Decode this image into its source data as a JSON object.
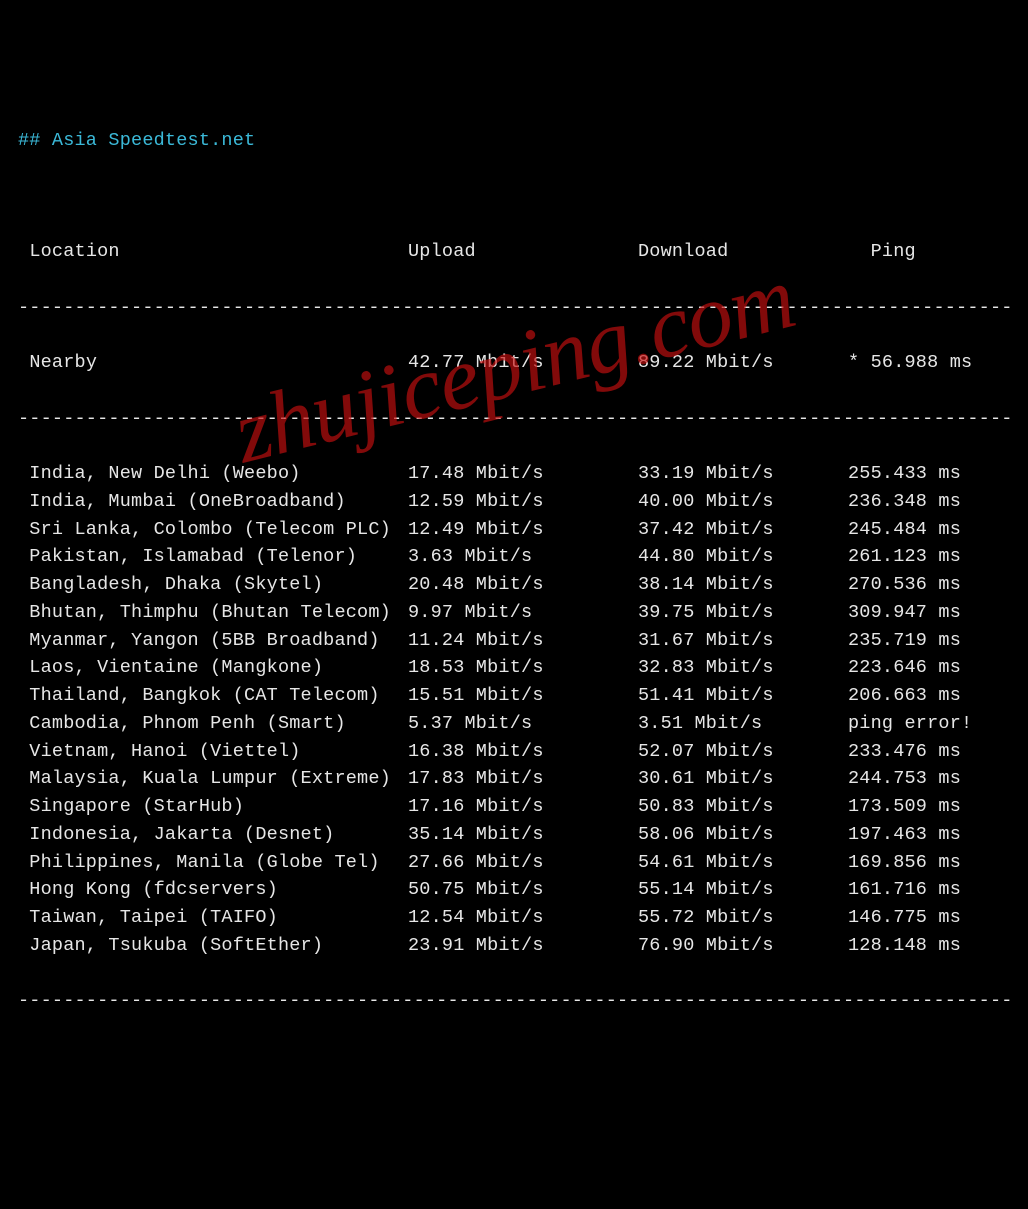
{
  "title": "## Asia Speedtest.net",
  "watermark": "zhujiceping.com",
  "divider": "----------------------------------------------------------------------------------------",
  "headers": {
    "location": "Location",
    "upload": "Upload",
    "download": "Download",
    "ping": "Ping"
  },
  "nearby": {
    "location": "Nearby",
    "upload": "42.77 Mbit/s",
    "download": "89.22 Mbit/s",
    "ping": "* 56.988 ms"
  },
  "rows": [
    {
      "location": "India, New Delhi (Weebo)",
      "upload": "17.48 Mbit/s",
      "download": "33.19 Mbit/s",
      "ping": "255.433 ms"
    },
    {
      "location": "India, Mumbai (OneBroadband)",
      "upload": "12.59 Mbit/s",
      "download": "40.00 Mbit/s",
      "ping": "236.348 ms"
    },
    {
      "location": "Sri Lanka, Colombo (Telecom PLC)",
      "upload": "12.49 Mbit/s",
      "download": "37.42 Mbit/s",
      "ping": "245.484 ms"
    },
    {
      "location": "Pakistan, Islamabad (Telenor)",
      "upload": "3.63 Mbit/s",
      "download": "44.80 Mbit/s",
      "ping": "261.123 ms"
    },
    {
      "location": "Bangladesh, Dhaka (Skytel)",
      "upload": "20.48 Mbit/s",
      "download": "38.14 Mbit/s",
      "ping": "270.536 ms"
    },
    {
      "location": "Bhutan, Thimphu (Bhutan Telecom)",
      "upload": "9.97 Mbit/s",
      "download": "39.75 Mbit/s",
      "ping": "309.947 ms"
    },
    {
      "location": "Myanmar, Yangon (5BB Broadband)",
      "upload": "11.24 Mbit/s",
      "download": "31.67 Mbit/s",
      "ping": "235.719 ms"
    },
    {
      "location": "Laos, Vientaine (Mangkone)",
      "upload": "18.53 Mbit/s",
      "download": "32.83 Mbit/s",
      "ping": "223.646 ms"
    },
    {
      "location": "Thailand, Bangkok (CAT Telecom)",
      "upload": "15.51 Mbit/s",
      "download": "51.41 Mbit/s",
      "ping": "206.663 ms"
    },
    {
      "location": "Cambodia, Phnom Penh (Smart)",
      "upload": "5.37 Mbit/s",
      "download": "3.51 Mbit/s",
      "ping": "ping error!"
    },
    {
      "location": "Vietnam, Hanoi (Viettel)",
      "upload": "16.38 Mbit/s",
      "download": "52.07 Mbit/s",
      "ping": "233.476 ms"
    },
    {
      "location": "Malaysia, Kuala Lumpur (Extreme)",
      "upload": "17.83 Mbit/s",
      "download": "30.61 Mbit/s",
      "ping": "244.753 ms"
    },
    {
      "location": "Singapore (StarHub)",
      "upload": "17.16 Mbit/s",
      "download": "50.83 Mbit/s",
      "ping": "173.509 ms"
    },
    {
      "location": "Indonesia, Jakarta (Desnet)",
      "upload": "35.14 Mbit/s",
      "download": "58.06 Mbit/s",
      "ping": "197.463 ms"
    },
    {
      "location": "Philippines, Manila (Globe Tel)",
      "upload": "27.66 Mbit/s",
      "download": "54.61 Mbit/s",
      "ping": "169.856 ms"
    },
    {
      "location": "Hong Kong (fdcservers)",
      "upload": "50.75 Mbit/s",
      "download": "55.14 Mbit/s",
      "ping": "161.716 ms"
    },
    {
      "location": "Taiwan, Taipei (TAIFO)",
      "upload": "12.54 Mbit/s",
      "download": "55.72 Mbit/s",
      "ping": "146.775 ms"
    },
    {
      "location": "Japan, Tsukuba (SoftEther)",
      "upload": "23.91 Mbit/s",
      "download": "76.90 Mbit/s",
      "ping": "128.148 ms"
    }
  ]
}
